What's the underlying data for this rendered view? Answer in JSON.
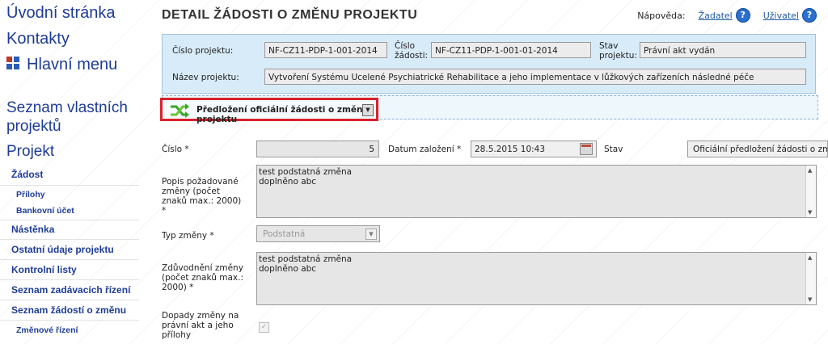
{
  "sidebar": {
    "home": "Úvodní stránka",
    "contacts": "Kontakty",
    "main_menu": "Hlavní menu",
    "own_projects": "Seznam vlastních projektů",
    "project": "Projekt",
    "items": [
      {
        "label": "Žádost",
        "level": 1
      },
      {
        "label": "Přílohy",
        "level": 2
      },
      {
        "label": "Bankovní účet",
        "level": 2
      },
      {
        "label": "Nástěnka",
        "level": 1
      },
      {
        "label": "Ostatní údaje projektu",
        "level": 1
      },
      {
        "label": "Kontrolní listy",
        "level": 1
      },
      {
        "label": "Seznam zadávacích řízení",
        "level": 1
      },
      {
        "label": "Seznam žádostí o změnu",
        "level": 1
      },
      {
        "label": "Změnové řízení",
        "level": 2
      }
    ]
  },
  "header": {
    "title": "DETAIL ŽÁDOSTI O ZMĚNU PROJEKTU",
    "help_label": "Nápověda:",
    "help_links": [
      "Žadatel",
      "Uživatel"
    ]
  },
  "project_info": {
    "project_number_label": "Číslo projektu:",
    "project_number": "NF-CZ11-PDP-1-001-2014",
    "request_number_label": "Číslo žádosti:",
    "request_number": "NF-CZ11-PDP-1-001-01-2014",
    "project_state_label": "Stav projektu:",
    "project_state": "Právní akt vydán",
    "project_name_label": "Název projektu:",
    "project_name": "Vytvoření Systému Ucelené Psychiatrické Rehabilitace a jeho implementace v lůžkových zařízeních následné péče"
  },
  "action": {
    "label": "Předložení oficiální žádosti o změnu projektu",
    "icon": "shuffle-icon"
  },
  "form": {
    "number_label": "Číslo *",
    "number_value": "5",
    "created_label": "Datum založení *",
    "created_value": "28.5.2015 10:43",
    "state_label": "Stav",
    "state_value": "Oficiální předložení žádosti o zm",
    "description_label": "Popis požadované změny (počet znaků max.: 2000) *",
    "description_value": "test podstatná změna\ndoplněno abc",
    "change_type_label": "Typ změny *",
    "change_type_value": "Podstatná",
    "justification_label": "Zdůvodnění změny (počet znaků max.: 2000) *",
    "justification_value": "test podstatná změna\ndoplněno abc",
    "impact_label": "Dopady změny na právní akt a jeho přílohy"
  },
  "colors": {
    "link": "#1e3c96",
    "info_bg": "#d8ebf8",
    "highlight": "#d9212a"
  }
}
